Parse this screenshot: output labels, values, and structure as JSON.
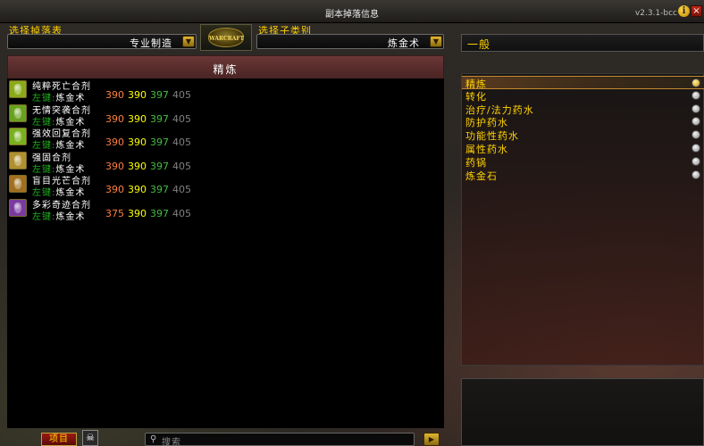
{
  "window": {
    "title": "副本掉落信息",
    "version": "v2.3.1-bcc",
    "info_label": "i",
    "close_label": "×"
  },
  "loot_table": {
    "label": "选择掉落表",
    "selected": "专业制造"
  },
  "sub_category": {
    "label": "选择子类别",
    "selected": "炼金术"
  },
  "logo": {
    "text": "WARCRAFT"
  },
  "list": {
    "header": "精炼",
    "items": [
      {
        "name": "纯粹死亡合剂",
        "source_key": "左键:",
        "source_val": "炼金术",
        "icon_color": "#8aaa1a",
        "skills": [
          "390",
          "390",
          "397",
          "405"
        ]
      },
      {
        "name": "无情突袭合剂",
        "source_key": "左键:",
        "source_val": "炼金术",
        "icon_color": "#6aa020",
        "skills": [
          "390",
          "390",
          "397",
          "405"
        ]
      },
      {
        "name": "强效回复合剂",
        "source_key": "左键:",
        "source_val": "炼金术",
        "icon_color": "#7ab020",
        "skills": [
          "390",
          "390",
          "397",
          "405"
        ]
      },
      {
        "name": "强固合剂",
        "source_key": "左键:",
        "source_val": "炼金术",
        "icon_color": "#b09030",
        "skills": [
          "390",
          "390",
          "397",
          "405"
        ]
      },
      {
        "name": "盲目光芒合剂",
        "source_key": "左键:",
        "source_val": "炼金术",
        "icon_color": "#a07020",
        "skills": [
          "390",
          "390",
          "397",
          "405"
        ]
      },
      {
        "name": "多彩奇迹合剂",
        "source_key": "左键:",
        "source_val": "炼金术",
        "icon_color": "#7a3aa0",
        "skills": [
          "375",
          "390",
          "397",
          "405"
        ]
      }
    ],
    "skill_colors": [
      "#ff7f3f",
      "#ffff00",
      "#40bf40",
      "#808080"
    ]
  },
  "right_panel": {
    "header": "一般",
    "categories": [
      {
        "label": "精炼",
        "selected": true
      },
      {
        "label": "转化",
        "selected": false
      },
      {
        "label": "治疗/法力药水",
        "selected": false
      },
      {
        "label": "防护药水",
        "selected": false
      },
      {
        "label": "功能性药水",
        "selected": false
      },
      {
        "label": "属性药水",
        "selected": false
      },
      {
        "label": "药锅",
        "selected": false
      },
      {
        "label": "炼金石",
        "selected": false
      }
    ]
  },
  "bottom": {
    "project_button": "项目",
    "search_placeholder": "搜索",
    "next_label": "▶"
  }
}
